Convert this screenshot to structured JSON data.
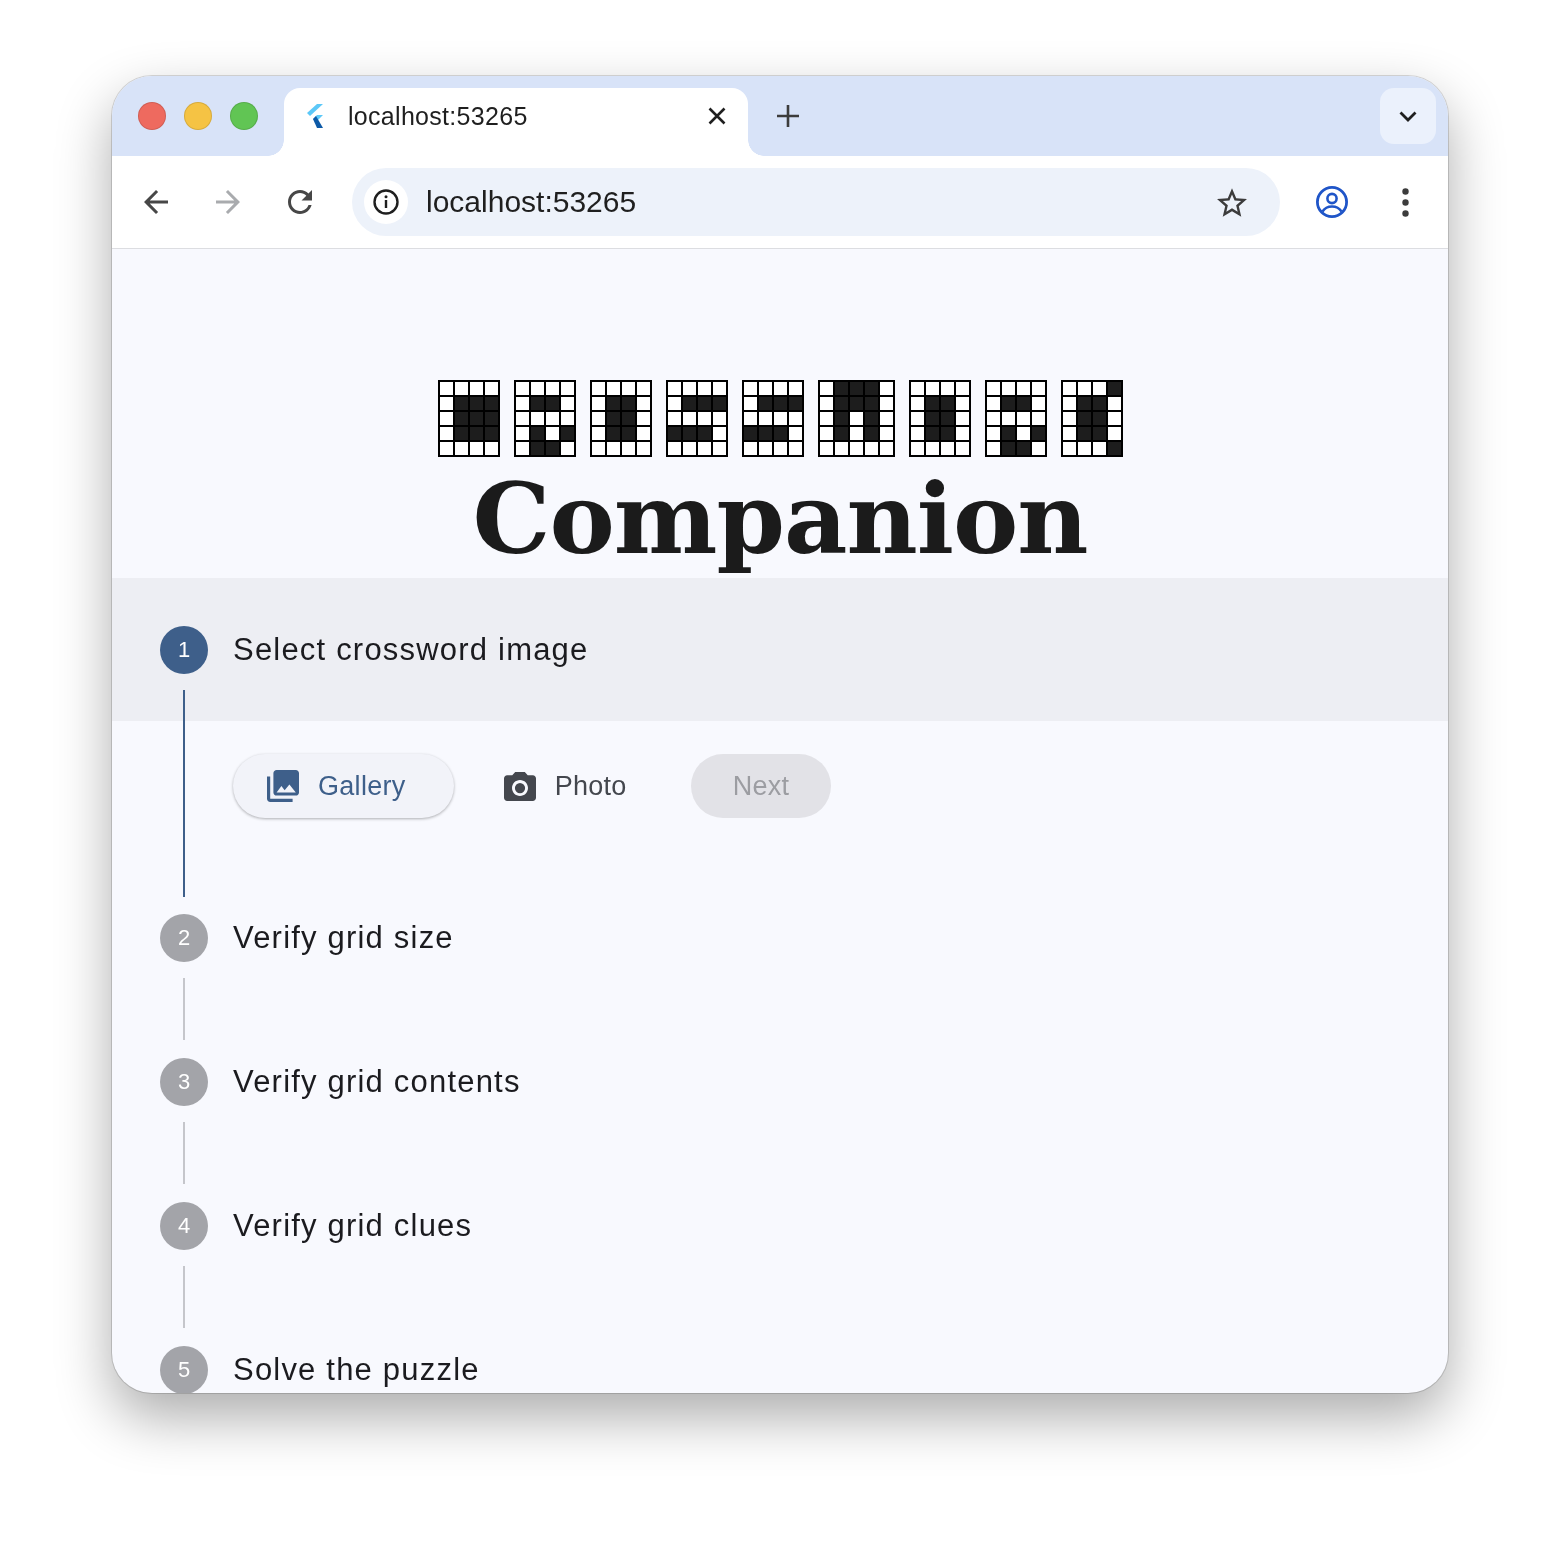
{
  "browser": {
    "tabs": [
      {
        "title": "localhost:53265",
        "selected": true
      }
    ],
    "nav_buttons": [
      {
        "kind": "back",
        "disabled": false
      },
      {
        "kind": "forward",
        "disabled": true
      },
      {
        "kind": "reload",
        "disabled": false
      }
    ],
    "address_bar": {
      "url": "localhost:53265"
    }
  },
  "app": {
    "title": "Companion",
    "steps": [
      {
        "number": "1",
        "label": "Select crossword image",
        "selected": true,
        "actions": [
          {
            "kind": "elevated",
            "label": "Gallery",
            "disabled": false
          },
          {
            "kind": "text",
            "label": "Photo",
            "disabled": false
          },
          {
            "kind": "filled",
            "label": "Next",
            "disabled": true
          }
        ]
      },
      {
        "number": "2",
        "label": "Verify grid size",
        "selected": false
      },
      {
        "number": "3",
        "label": "Verify grid contents",
        "selected": false
      },
      {
        "number": "4",
        "label": "Verify grid clues",
        "selected": false
      },
      {
        "number": "5",
        "label": "Solve the puzzle",
        "selected": false
      }
    ]
  }
}
